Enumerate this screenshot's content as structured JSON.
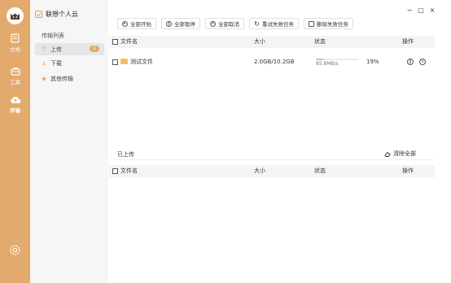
{
  "rail": {
    "items": [
      {
        "label": "文档",
        "icon": "document-icon"
      },
      {
        "label": "工具",
        "icon": "toolbox-icon"
      },
      {
        "label": "传输",
        "icon": "cloud-transfer-icon"
      }
    ],
    "accent": "#e2aa6c"
  },
  "sidebar": {
    "brand": "联想个人云",
    "section": "传输列表",
    "items": [
      {
        "label": "上传",
        "icon": "upload-icon",
        "badge": "1"
      },
      {
        "label": "下载",
        "icon": "download-icon"
      },
      {
        "label": "其他传输",
        "icon": "other-transfer-icon"
      }
    ]
  },
  "window": {
    "minimize": "−",
    "maximize": "□",
    "close": "×"
  },
  "toolbar": {
    "start_all": "全部开始",
    "pause_all": "全部暂停",
    "cancel_all": "全部取消",
    "retry_failed": "重试失败任务",
    "delete_failed": "删除失败任务"
  },
  "upload_table": {
    "columns": {
      "name": "文件名",
      "size": "大小",
      "status": "状态",
      "actions": "操作"
    },
    "rows": [
      {
        "name": "测试文件",
        "size": "2.0GB/10.2GB",
        "speed": "85.8MB/s",
        "progress": 0.19,
        "percent": "19%"
      }
    ]
  },
  "done_section": {
    "title": "已上传",
    "clear_all": "清除全部",
    "columns": {
      "name": "文件名",
      "size": "大小",
      "status": "状态",
      "actions": "操作"
    }
  }
}
